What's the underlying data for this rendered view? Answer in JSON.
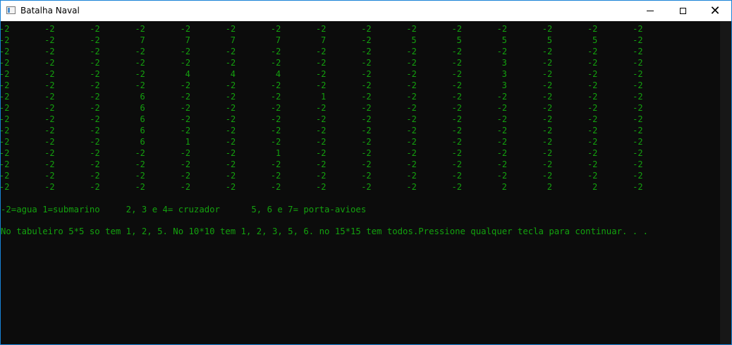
{
  "window": {
    "title": "Batalha Naval",
    "icon": "console-window-icon"
  },
  "board": {
    "rows": [
      [
        "-2",
        "-2",
        "-2",
        "-2",
        "-2",
        "-2",
        "-2",
        "-2",
        "-2",
        "-2",
        "-2",
        "-2",
        "-2",
        "-2",
        "-2"
      ],
      [
        "-2",
        "-2",
        "-2",
        "7",
        "7",
        "7",
        "7",
        "7",
        "-2",
        "5",
        "5",
        "5",
        "5",
        "5",
        "-2"
      ],
      [
        "-2",
        "-2",
        "-2",
        "-2",
        "-2",
        "-2",
        "-2",
        "-2",
        "-2",
        "-2",
        "-2",
        "-2",
        "-2",
        "-2",
        "-2"
      ],
      [
        "-2",
        "-2",
        "-2",
        "-2",
        "-2",
        "-2",
        "-2",
        "-2",
        "-2",
        "-2",
        "-2",
        "3",
        "-2",
        "-2",
        "-2"
      ],
      [
        "-2",
        "-2",
        "-2",
        "-2",
        "4",
        "4",
        "4",
        "-2",
        "-2",
        "-2",
        "-2",
        "3",
        "-2",
        "-2",
        "-2"
      ],
      [
        "-2",
        "-2",
        "-2",
        "-2",
        "-2",
        "-2",
        "-2",
        "-2",
        "-2",
        "-2",
        "-2",
        "3",
        "-2",
        "-2",
        "-2"
      ],
      [
        "-2",
        "-2",
        "-2",
        "6",
        "-2",
        "-2",
        "-2",
        "1",
        "-2",
        "-2",
        "-2",
        "-2",
        "-2",
        "-2",
        "-2"
      ],
      [
        "-2",
        "-2",
        "-2",
        "6",
        "-2",
        "-2",
        "-2",
        "-2",
        "-2",
        "-2",
        "-2",
        "-2",
        "-2",
        "-2",
        "-2"
      ],
      [
        "-2",
        "-2",
        "-2",
        "6",
        "-2",
        "-2",
        "-2",
        "-2",
        "-2",
        "-2",
        "-2",
        "-2",
        "-2",
        "-2",
        "-2"
      ],
      [
        "-2",
        "-2",
        "-2",
        "6",
        "-2",
        "-2",
        "-2",
        "-2",
        "-2",
        "-2",
        "-2",
        "-2",
        "-2",
        "-2",
        "-2"
      ],
      [
        "-2",
        "-2",
        "-2",
        "6",
        "1",
        "-2",
        "-2",
        "-2",
        "-2",
        "-2",
        "-2",
        "-2",
        "-2",
        "-2",
        "-2"
      ],
      [
        "-2",
        "-2",
        "-2",
        "-2",
        "-2",
        "-2",
        "1",
        "-2",
        "-2",
        "-2",
        "-2",
        "-2",
        "-2",
        "-2",
        "-2"
      ],
      [
        "-2",
        "-2",
        "-2",
        "-2",
        "-2",
        "-2",
        "-2",
        "-2",
        "-2",
        "-2",
        "-2",
        "-2",
        "-2",
        "-2",
        "-2"
      ],
      [
        "-2",
        "-2",
        "-2",
        "-2",
        "-2",
        "-2",
        "-2",
        "-2",
        "-2",
        "-2",
        "-2",
        "-2",
        "-2",
        "-2",
        "-2"
      ],
      [
        "-2",
        "-2",
        "-2",
        "-2",
        "-2",
        "-2",
        "-2",
        "-2",
        "-2",
        "-2",
        "-2",
        "2",
        "2",
        "2",
        "-2"
      ]
    ]
  },
  "legend": "-2=agua 1=submarino     2, 3 e 4= cruzador      5, 6 e 7= porta-avioes",
  "info": "No tabuleiro 5*5 so tem 1, 2, 5. No 10*10 tem 1, 2, 3, 5, 6. no 15*15 tem todos.Pressione qualquer tecla para continuar. . .",
  "colors": {
    "console_bg": "#0c0c0c",
    "console_text": "#13a10e",
    "titlebar_bg": "#ffffff"
  }
}
